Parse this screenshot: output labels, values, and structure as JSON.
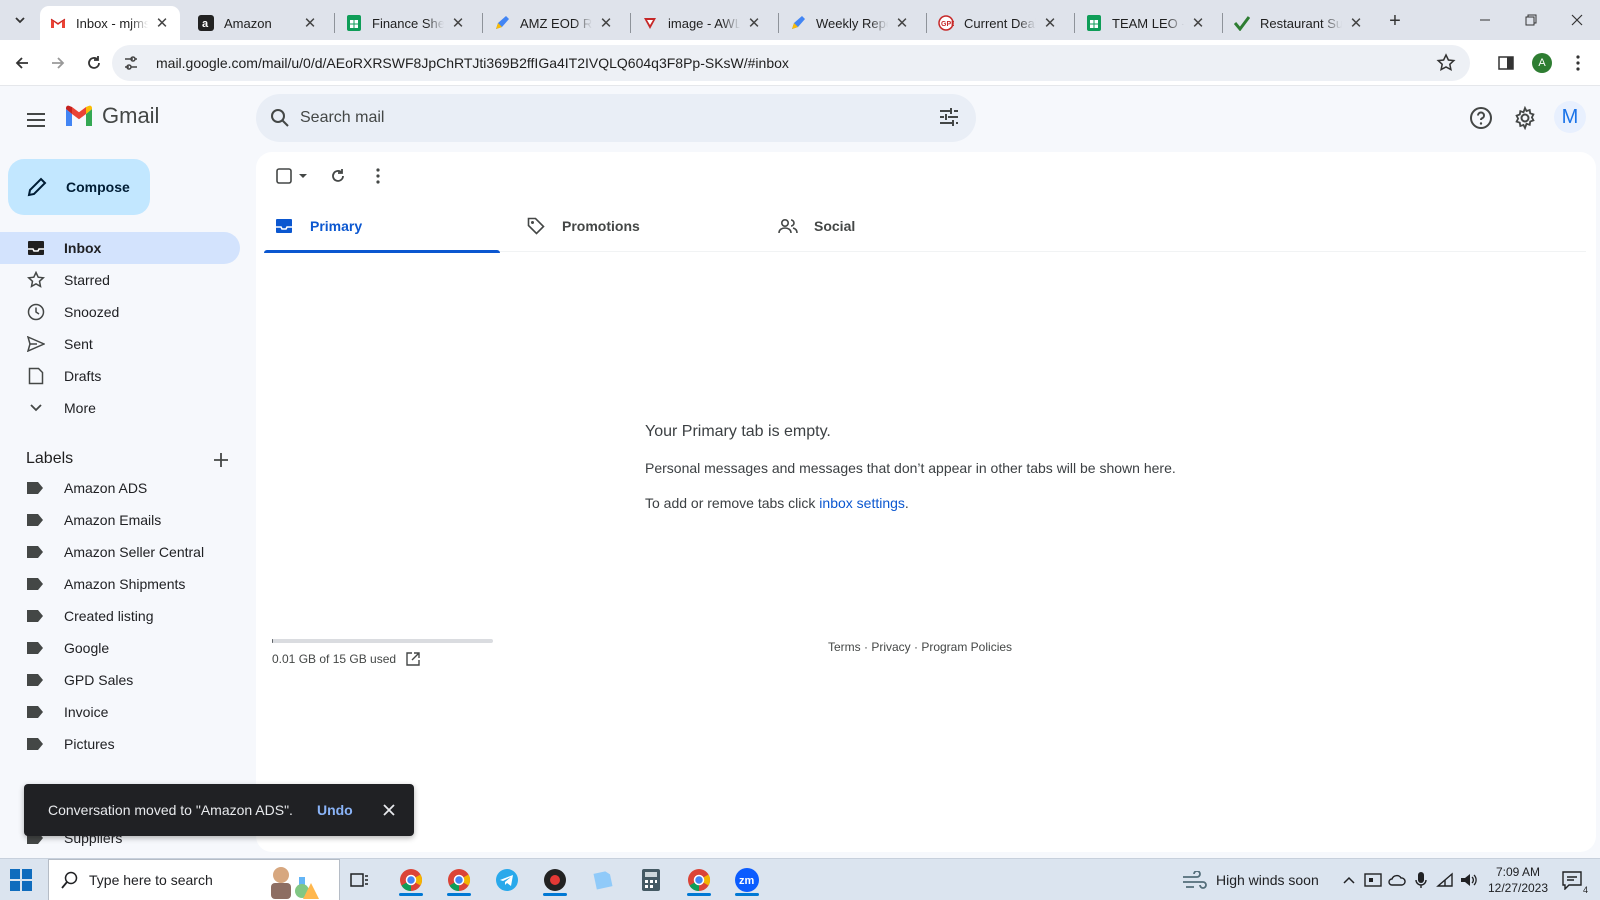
{
  "browser": {
    "tabs": [
      {
        "title": "Inbox - mjmstore",
        "favicon": "gmail-icon",
        "active": true
      },
      {
        "title": "Amazon",
        "favicon": "amazon-icon"
      },
      {
        "title": "Finance Sheet",
        "favicon": "sheets-icon"
      },
      {
        "title": "AMZ EOD Report",
        "favicon": "pen-icon"
      },
      {
        "title": "image - AWL Labs",
        "favicon": "heart-icon"
      },
      {
        "title": "Weekly Report",
        "favicon": "pen-icon"
      },
      {
        "title": "Current Deals",
        "favicon": "deals-icon"
      },
      {
        "title": "TEAM LEO - Google",
        "favicon": "sheets-icon"
      },
      {
        "title": "Restaurant Supply",
        "favicon": "check-icon"
      }
    ],
    "url": "mail.google.com/mail/u/0/d/AEoRXRSWF8JpChRTJti369B2ffIGa4IT2IVQLQ604q3F8Pp-SKsW/#inbox",
    "profile_initial": "A"
  },
  "gmail": {
    "logo_text": "Gmail",
    "search_placeholder": "Search mail",
    "avatar_initial": "M",
    "compose_label": "Compose",
    "nav": [
      {
        "label": "Inbox",
        "icon": "inbox-icon",
        "active": true
      },
      {
        "label": "Starred",
        "icon": "star-icon"
      },
      {
        "label": "Snoozed",
        "icon": "clock-icon"
      },
      {
        "label": "Sent",
        "icon": "send-icon"
      },
      {
        "label": "Drafts",
        "icon": "draft-icon"
      },
      {
        "label": "More",
        "icon": "chevron-down-icon"
      }
    ],
    "labels_title": "Labels",
    "labels": [
      "Amazon ADS",
      "Amazon Emails",
      "Amazon Seller Central",
      "Amazon Shipments",
      "Created listing",
      "Google",
      "GPD Sales",
      "Invoice",
      "Pictures",
      "Suppliers"
    ],
    "tabs": [
      {
        "label": "Primary",
        "icon": "inbox-icon",
        "active": true
      },
      {
        "label": "Promotions",
        "icon": "tag-icon"
      },
      {
        "label": "Social",
        "icon": "people-icon"
      }
    ],
    "empty": {
      "title": "Your Primary tab is empty.",
      "line1": "Personal messages and messages that don’t appear in other tabs will be shown here.",
      "line2_prefix": "To add or remove tabs click ",
      "line2_link": "inbox settings",
      "line2_suffix": "."
    },
    "storage": {
      "text": "0.01 GB of 15 GB used",
      "fraction": 0.001
    },
    "footer": "Terms · Privacy · Program Policies",
    "toast": {
      "message": "Conversation moved to \"Amazon ADS\".",
      "action": "Undo"
    }
  },
  "taskbar": {
    "search_placeholder": "Type here to search",
    "weather": "High winds soon",
    "time": "7:09 AM",
    "date": "12/27/2023",
    "notification_count": "4"
  },
  "colors": {
    "accent": "#0b57d0",
    "compose_bg": "#c2e7ff",
    "nav_active": "#d3e3fd"
  }
}
